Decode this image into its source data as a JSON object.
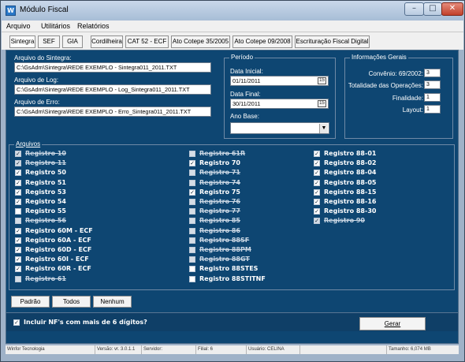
{
  "window": {
    "title": "Módulo Fiscal",
    "app_icon_glyph": "W",
    "controls": {
      "minimize": "–",
      "maximize": "□",
      "close": "✕"
    }
  },
  "menu": [
    "Arquivo",
    "Utilitários",
    "Relatórios"
  ],
  "tabs": [
    "Sintegra",
    "SEF",
    "GIA",
    "Cordilheira",
    "CAT 52 - ECF",
    "Ato Cotepe 35/2005",
    "Ato Cotepe 09/2008",
    "Escrituração Fiscal Digital"
  ],
  "files": {
    "sintegra_label": "Arquivo do Sintegra:",
    "sintegra_value": "C:\\GsAdm\\Sintegra\\REDE    EXEMPLO  - Sintegra011_2011.TXT",
    "log_label": "Arquivo de Log:",
    "log_value": "C:\\GsAdm\\Sintegra\\REDE    EXEMPLO  - Log_Sintegra011_2011.TXT",
    "erro_label": "Arquivo de Erro:",
    "erro_value": "C:\\GsAdm\\Sintegra\\REDE    EXEMPLO  - Erro_Sintegra011_2011.TXT"
  },
  "periodo": {
    "title": "Período",
    "data_inicial_label": "Data Inicial:",
    "data_inicial_value": "01/11/2011",
    "data_final_label": "Data Final:",
    "data_final_value": "30/11/2011",
    "ano_base_label": "Ano Base:",
    "ano_base_value": "",
    "calendar_icon_glyph": "15",
    "combo_arrow_glyph": "▼"
  },
  "info_gerais": {
    "title": "Informações Gerais",
    "convenio_label": "Convênio: 69/2002:",
    "convenio_value": "3",
    "totalidade_label": "Totalidade das Operações:",
    "totalidade_value": "3",
    "finalidade_label": "Finalidade:",
    "finalidade_value": "1",
    "layout_label": "Layout:",
    "layout_value": "1"
  },
  "arquivos": {
    "title": "Arquivos",
    "check_glyph": "✓",
    "columns": [
      [
        {
          "label": "Registro 10",
          "checked": true,
          "enabled": false
        },
        {
          "label": "Registro 11",
          "checked": true,
          "enabled": false
        },
        {
          "label": "Registro 50",
          "checked": true,
          "enabled": true
        },
        {
          "label": "Registro 51",
          "checked": true,
          "enabled": true
        },
        {
          "label": "Registro 53",
          "checked": true,
          "enabled": true
        },
        {
          "label": "Registro 54",
          "checked": true,
          "enabled": true
        },
        {
          "label": "Registro 55",
          "checked": false,
          "enabled": true
        },
        {
          "label": "Registro 56",
          "checked": false,
          "enabled": false
        },
        {
          "label": "Registro 60M - ECF",
          "checked": true,
          "enabled": true
        },
        {
          "label": "Registro 60A - ECF",
          "checked": true,
          "enabled": true
        },
        {
          "label": "Registro 60D - ECF",
          "checked": true,
          "enabled": true
        },
        {
          "label": "Registro 60I - ECF",
          "checked": true,
          "enabled": true
        },
        {
          "label": "Registro 60R - ECF",
          "checked": true,
          "enabled": true
        },
        {
          "label": "Registro 61",
          "checked": false,
          "enabled": false
        }
      ],
      [
        {
          "label": "Registro 61R",
          "checked": false,
          "enabled": false
        },
        {
          "label": "Registro 70",
          "checked": true,
          "enabled": true
        },
        {
          "label": "Registro 71",
          "checked": false,
          "enabled": false
        },
        {
          "label": "Registro 74",
          "checked": false,
          "enabled": false
        },
        {
          "label": "Registro 75",
          "checked": true,
          "enabled": true
        },
        {
          "label": "Registro 76",
          "checked": false,
          "enabled": false
        },
        {
          "label": "Registro 77",
          "checked": false,
          "enabled": false
        },
        {
          "label": "Registro 85",
          "checked": false,
          "enabled": false
        },
        {
          "label": "Registro 86",
          "checked": false,
          "enabled": false
        },
        {
          "label": "Registro 88SF",
          "checked": false,
          "enabled": false
        },
        {
          "label": "Registro 88PM",
          "checked": false,
          "enabled": false
        },
        {
          "label": "Registro 88GT",
          "checked": false,
          "enabled": false
        },
        {
          "label": "Registro 88STES",
          "checked": false,
          "enabled": true
        },
        {
          "label": "Registro 88STITNF",
          "checked": false,
          "enabled": true
        }
      ],
      [
        {
          "label": "Registro 88-01",
          "checked": true,
          "enabled": true
        },
        {
          "label": "Registro 88-02",
          "checked": true,
          "enabled": true
        },
        {
          "label": "Registro 88-04",
          "checked": true,
          "enabled": true
        },
        {
          "label": "Registro 88-05",
          "checked": true,
          "enabled": true
        },
        {
          "label": "Registro 88-15",
          "checked": true,
          "enabled": true
        },
        {
          "label": "Registro 88-16",
          "checked": true,
          "enabled": true
        },
        {
          "label": "Registro 88-30",
          "checked": true,
          "enabled": true
        },
        {
          "label": "Registro 90",
          "checked": true,
          "enabled": false
        }
      ]
    ]
  },
  "actions": {
    "padrao": "Padrão",
    "todos": "Todos",
    "nenhum": "Nenhum"
  },
  "footer": {
    "incluir_nf_label": "Incluir NF's com mais de 6 dígitos?",
    "incluir_nf_checked": true,
    "gerar_label": "Gerar"
  },
  "statusbar": [
    "Winfor Tecnologia",
    "Versão: vr. 3.0.1.1",
    "Servidor:",
    "Filial: 6",
    "Usuário: CELINA",
    "",
    "Tamanho: 6,074 MB"
  ]
}
